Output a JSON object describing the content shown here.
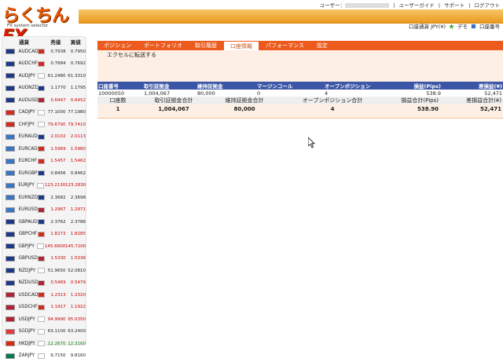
{
  "logo": {
    "text_main": "らくちん",
    "text_fx": "FX",
    "subtitle": "FX system selector"
  },
  "toplinks": {
    "user_label": "ユーザー：",
    "guide": "ユーザーガイド",
    "support": "サポート",
    "logout": "ログアウト"
  },
  "account_info": {
    "currency": "口座通貨 JPY(¥)",
    "demo": "デモ",
    "account_no": "口座番号"
  },
  "sidebar": {
    "headers": {
      "currency": "通貨",
      "bid": "売値",
      "ask": "買値"
    },
    "rates": [
      {
        "symbol": "AUDCAD",
        "bid": "0.7938",
        "ask": "0.7950",
        "color": "blk",
        "flag": "#1d3a8a",
        "quote": "#d52b1e"
      },
      {
        "symbol": "AUDCHF",
        "bid": "0.7684",
        "ask": "0.7692",
        "color": "blk",
        "flag": "#1d3a8a",
        "quote": "#d52b1e"
      },
      {
        "symbol": "AUDJPY",
        "bid": "61.2480",
        "ask": "61.3310",
        "color": "blk",
        "flag": "#1d3a8a",
        "quote": "#ffffff"
      },
      {
        "symbol": "AUDNZD",
        "bid": "1.1770",
        "ask": "1.1795",
        "color": "blk",
        "flag": "#1d3a8a",
        "quote": "#1d3a8a"
      },
      {
        "symbol": "AUDUSD",
        "bid": "0.6447",
        "ask": "0.6452",
        "color": "red",
        "flag": "#1d3a8a",
        "quote": "#b22234"
      },
      {
        "symbol": "CADJPY",
        "bid": "77.1000",
        "ask": "77.1980",
        "color": "blk",
        "flag": "#d52b1e",
        "quote": "#ffffff"
      },
      {
        "symbol": "CHFJPY",
        "bid": "79.6790",
        "ask": "79.7410",
        "color": "red",
        "flag": "#d52b1e",
        "quote": "#ffffff"
      },
      {
        "symbol": "EURAUD",
        "bid": "2.0102",
        "ask": "2.0113",
        "color": "red",
        "flag": "#3a76c4",
        "quote": "#1d3a8a"
      },
      {
        "symbol": "EURCAD",
        "bid": "1.5969",
        "ask": "1.5980",
        "color": "red",
        "flag": "#3a76c4",
        "quote": "#d52b1e"
      },
      {
        "symbol": "EURCHF",
        "bid": "1.5457",
        "ask": "1.5462",
        "color": "red",
        "flag": "#3a76c4",
        "quote": "#d52b1e"
      },
      {
        "symbol": "EURGBP",
        "bid": "0.8456",
        "ask": "0.8462",
        "color": "blk",
        "flag": "#3a76c4",
        "quote": "#1d3a8a"
      },
      {
        "symbol": "EURJPY",
        "bid": "123.2130",
        "ask": "123.2830",
        "color": "red",
        "flag": "#3a76c4",
        "quote": "#ffffff"
      },
      {
        "symbol": "EURNZD",
        "bid": "2.3682",
        "ask": "2.3698",
        "color": "blk",
        "flag": "#3a76c4",
        "quote": "#1d3a8a"
      },
      {
        "symbol": "EURUSD",
        "bid": "1.2967",
        "ask": "1.2971",
        "color": "red",
        "flag": "#3a76c4",
        "quote": "#b22234"
      },
      {
        "symbol": "GBPAUD",
        "bid": "2.3762",
        "ask": "2.3786",
        "color": "blk",
        "flag": "#1d3a8a",
        "quote": "#1d3a8a"
      },
      {
        "symbol": "GBPCHF",
        "bid": "1.8273",
        "ask": "1.8285",
        "color": "red",
        "flag": "#1d3a8a",
        "quote": "#d52b1e"
      },
      {
        "symbol": "GBPJPY",
        "bid": "145.6600",
        "ask": "145.7200",
        "color": "red",
        "flag": "#1d3a8a",
        "quote": "#ffffff"
      },
      {
        "symbol": "GBPUSD",
        "bid": "1.5330",
        "ask": "1.5336",
        "color": "red",
        "flag": "#1d3a8a",
        "quote": "#b22234"
      },
      {
        "symbol": "NZDJPY",
        "bid": "51.9650",
        "ask": "52.0810",
        "color": "blk",
        "flag": "#1d3a8a",
        "quote": "#ffffff"
      },
      {
        "symbol": "NZDUSD",
        "bid": "0.5469",
        "ask": "0.5479",
        "color": "red",
        "flag": "#1d3a8a",
        "quote": "#b22234"
      },
      {
        "symbol": "USDCAD",
        "bid": "1.2313",
        "ask": "1.2320",
        "color": "red",
        "flag": "#b22234",
        "quote": "#d52b1e"
      },
      {
        "symbol": "USDCHF",
        "bid": "1.1917",
        "ask": "1.1922",
        "color": "red",
        "flag": "#b22234",
        "quote": "#d52b1e"
      },
      {
        "symbol": "USDJPY",
        "bid": "94.9990",
        "ask": "95.0350",
        "color": "red",
        "flag": "#b22234",
        "quote": "#ffffff"
      },
      {
        "symbol": "SGDJPY",
        "bid": "63.1100",
        "ask": "63.2400",
        "color": "blk",
        "flag": "#e03a3e",
        "quote": "#ffffff"
      },
      {
        "symbol": "HKDJPY",
        "bid": "12.2670",
        "ask": "12.3160",
        "color": "green",
        "flag": "#de2910",
        "quote": "#ffffff"
      },
      {
        "symbol": "ZARJPY",
        "bid": "9.7150",
        "ask": "9.8160",
        "color": "blk",
        "flag": "#007a4d",
        "quote": "#ffffff"
      }
    ]
  },
  "tabs": [
    {
      "label": "ポジション",
      "active": false
    },
    {
      "label": "ポートフォリオ",
      "active": false
    },
    {
      "label": "取引履歴",
      "active": false
    },
    {
      "label": "口座情報",
      "active": true
    },
    {
      "label": "パフォーマンス",
      "active": false
    },
    {
      "label": "設定",
      "active": false
    }
  ],
  "excel_link": "エクセルに転送する",
  "account_table": {
    "headers": [
      "口座番号",
      "取引証拠金",
      "維持証拠金",
      "マージンコール",
      "オープンポジション",
      "損益(Pips)",
      "差損益(¥)"
    ],
    "row": [
      "10000050",
      "1,004,067",
      "80,000",
      "0",
      "4",
      "538.9",
      "52,471"
    ]
  },
  "summary_table": {
    "headers": [
      "口座数",
      "取引証拠金合計",
      "維持証拠金合計",
      "オープンポジション合計",
      "損益合計(Pips)",
      "差損益合計(¥)"
    ],
    "row": [
      "1",
      "1,004,067",
      "80,000",
      "4",
      "538.90",
      "52,471"
    ]
  }
}
